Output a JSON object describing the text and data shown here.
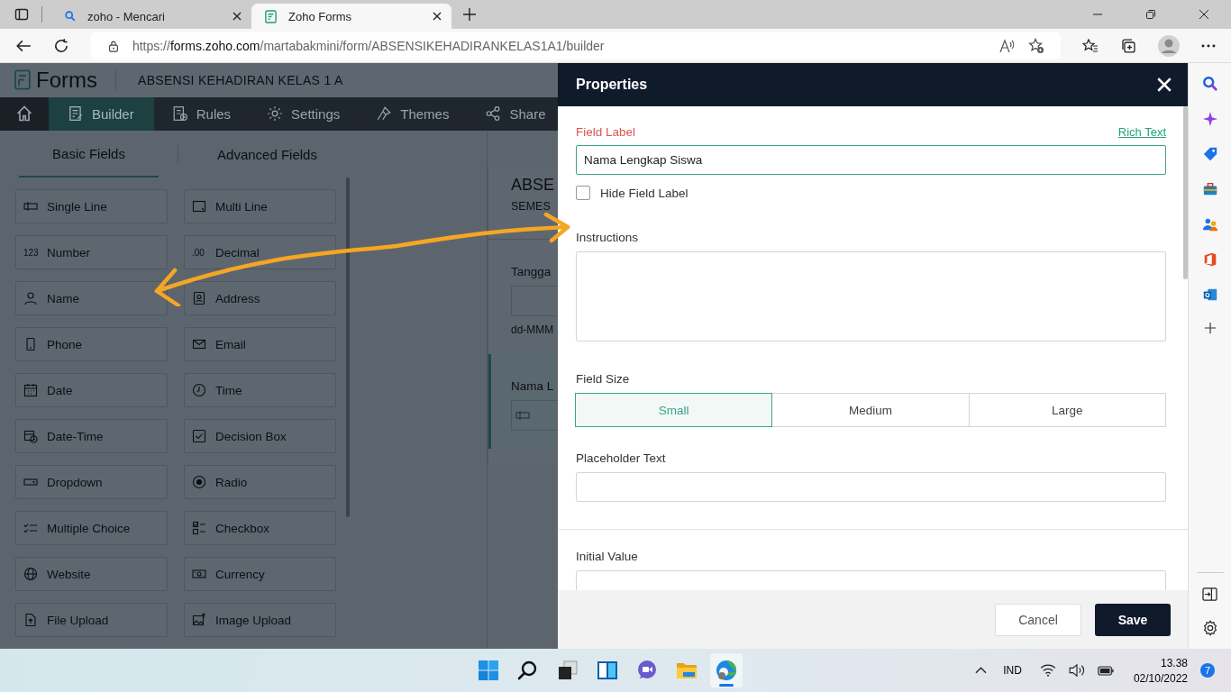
{
  "browser": {
    "tabs": [
      {
        "title": "zoho - Mencari",
        "kind": "search",
        "selected": false
      },
      {
        "title": "Zoho Forms",
        "kind": "forms",
        "selected": true
      }
    ],
    "url": {
      "scheme": "https://",
      "host": "forms.zoho.com",
      "path": "/martabakmini/form/ABSENSIKEHADIRANKELAS1A1/builder"
    }
  },
  "app": {
    "logo": "Forms",
    "form_title": "ABSENSI KEHADIRAN KELAS 1 A",
    "nav": [
      {
        "label": "Builder",
        "kind": "builder",
        "selected": true
      },
      {
        "label": "Rules",
        "kind": "rules",
        "selected": false
      },
      {
        "label": "Settings",
        "kind": "gear",
        "selected": false
      },
      {
        "label": "Themes",
        "kind": "themes",
        "selected": false
      },
      {
        "label": "Share",
        "kind": "share",
        "selected": false
      }
    ],
    "field_tabs": [
      {
        "label": "Basic Fields",
        "selected": true
      },
      {
        "label": "Advanced Fields",
        "selected": false
      }
    ],
    "fields": [
      {
        "label": "Single Line",
        "kind": "input"
      },
      {
        "label": "Multi Line",
        "kind": "multi"
      },
      {
        "label": "Number",
        "kind": "glyph",
        "glyph": "123"
      },
      {
        "label": "Decimal",
        "kind": "glyph",
        "glyph": ".00"
      },
      {
        "label": "Name",
        "kind": "person"
      },
      {
        "label": "Address",
        "kind": "address"
      },
      {
        "label": "Phone",
        "kind": "phone"
      },
      {
        "label": "Email",
        "kind": "email"
      },
      {
        "label": "Date",
        "kind": "date"
      },
      {
        "label": "Time",
        "kind": "time"
      },
      {
        "label": "Date-Time",
        "kind": "datetime"
      },
      {
        "label": "Decision Box",
        "kind": "decision"
      },
      {
        "label": "Dropdown",
        "kind": "dropdown"
      },
      {
        "label": "Radio",
        "kind": "radio"
      },
      {
        "label": "Multiple Choice",
        "kind": "multiple"
      },
      {
        "label": "Checkbox",
        "kind": "checkbox"
      },
      {
        "label": "Website",
        "kind": "website"
      },
      {
        "label": "Currency",
        "kind": "currency"
      },
      {
        "label": "File Upload",
        "kind": "fileupload"
      },
      {
        "label": "Image Upload",
        "kind": "imageupload"
      }
    ],
    "canvas": {
      "title": "ABSE",
      "subtitle": "SEMES",
      "fields": [
        {
          "label": "Tangga",
          "hint": "dd-MMM",
          "selected": false
        },
        {
          "label": "Nama L",
          "selected": true
        }
      ]
    }
  },
  "properties": {
    "title": "Properties",
    "field_label": {
      "label": "Field Label",
      "link": "Rich Text",
      "value": "Nama Lengkap Siswa"
    },
    "hide_label": {
      "label": "Hide Field Label",
      "checked": false
    },
    "instructions": {
      "label": "Instructions"
    },
    "field_size": {
      "label": "Field Size",
      "options": [
        {
          "label": "Small",
          "selected": true
        },
        {
          "label": "Medium",
          "selected": false
        },
        {
          "label": "Large",
          "selected": false
        }
      ]
    },
    "placeholder_text": {
      "label": "Placeholder Text"
    },
    "initial_value": {
      "label": "Initial Value"
    },
    "buttons": [
      {
        "label": "Cancel",
        "kind": "secondary"
      },
      {
        "label": "Save",
        "kind": "primary"
      }
    ]
  },
  "taskbar": {
    "apps": [
      {
        "kind": "start",
        "selected": false
      },
      {
        "kind": "search",
        "selected": false
      },
      {
        "kind": "taskview",
        "selected": false
      },
      {
        "kind": "widgets",
        "selected": false
      },
      {
        "kind": "chat",
        "selected": false
      },
      {
        "kind": "explorer",
        "selected": false
      },
      {
        "kind": "edge",
        "selected": true
      }
    ],
    "language": "IND",
    "time": "13.38",
    "date": "02/10/2022",
    "notifications": "7"
  }
}
